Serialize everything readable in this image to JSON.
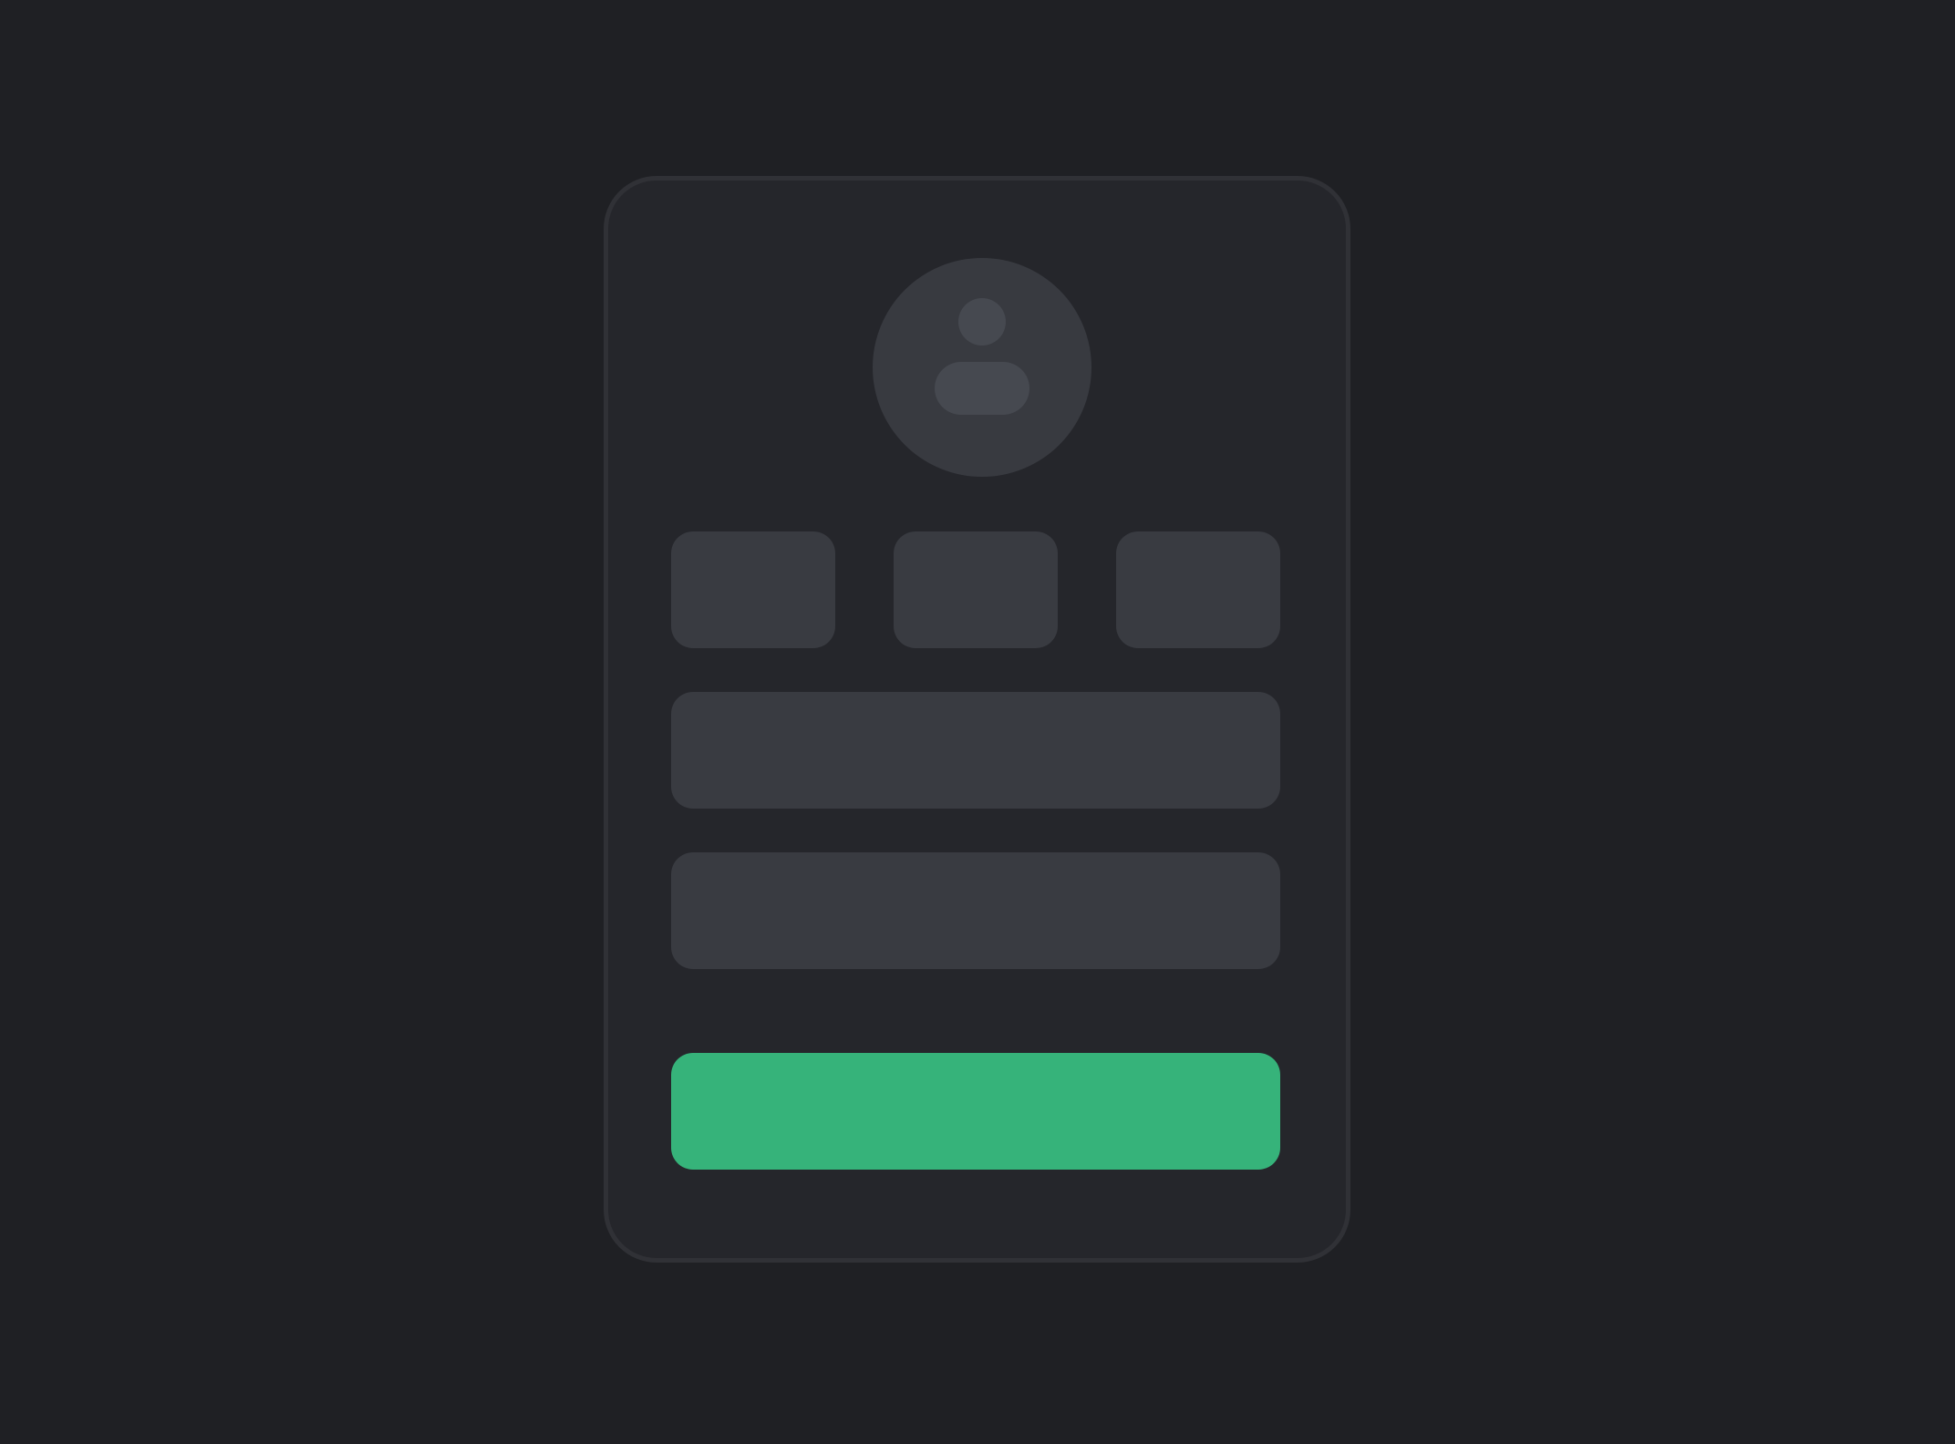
{
  "colors": {
    "background": "#1f2024",
    "card": "#25262b",
    "card_border": "#303136",
    "placeholder": "#393b41",
    "avatar_bg": "#383a40",
    "avatar_icon": "#464950",
    "accent": "#36b37a"
  },
  "avatar": {
    "icon": "user-icon"
  },
  "tiles": [
    {
      "label": ""
    },
    {
      "label": ""
    },
    {
      "label": ""
    }
  ],
  "fields": [
    {
      "value": "",
      "placeholder": ""
    },
    {
      "value": "",
      "placeholder": ""
    }
  ],
  "primary_button": {
    "label": ""
  }
}
